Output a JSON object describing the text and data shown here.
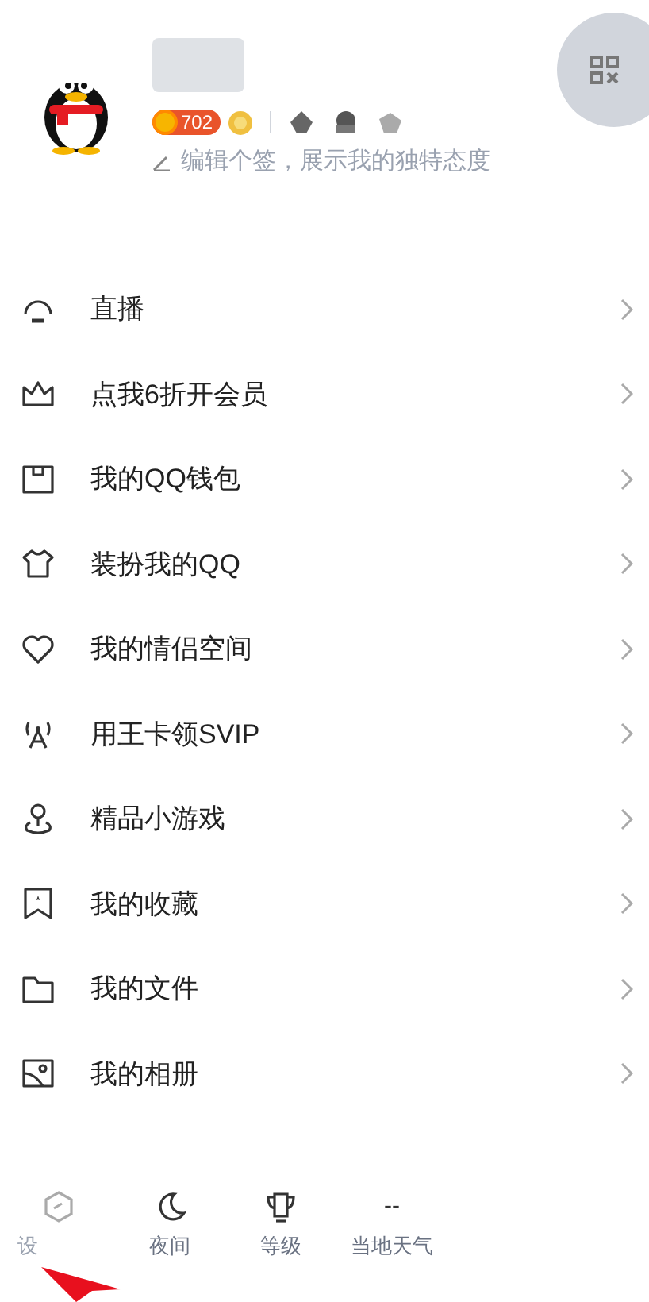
{
  "profile": {
    "level_badge": "702",
    "signature": "编辑个签，展示我的独特态度"
  },
  "menu": [
    {
      "kind": "live",
      "label": "直播"
    },
    {
      "kind": "crown",
      "label": "点我6折开会员"
    },
    {
      "kind": "wallet",
      "label": "我的QQ钱包"
    },
    {
      "kind": "shirt",
      "label": "装扮我的QQ"
    },
    {
      "kind": "heart",
      "label": "我的情侣空间"
    },
    {
      "kind": "signal",
      "label": "用王卡领SVIP"
    },
    {
      "kind": "game",
      "label": "精品小游戏"
    },
    {
      "kind": "bookmark",
      "label": "我的收藏"
    },
    {
      "kind": "folder",
      "label": "我的文件"
    },
    {
      "kind": "photo",
      "label": "我的相册"
    }
  ],
  "bottom_bar": [
    {
      "kind": "settings",
      "label": "设"
    },
    {
      "kind": "night",
      "label": "夜间"
    },
    {
      "kind": "level",
      "label": "等级"
    },
    {
      "kind": "weather",
      "value": "--",
      "label": "当地天气"
    }
  ]
}
